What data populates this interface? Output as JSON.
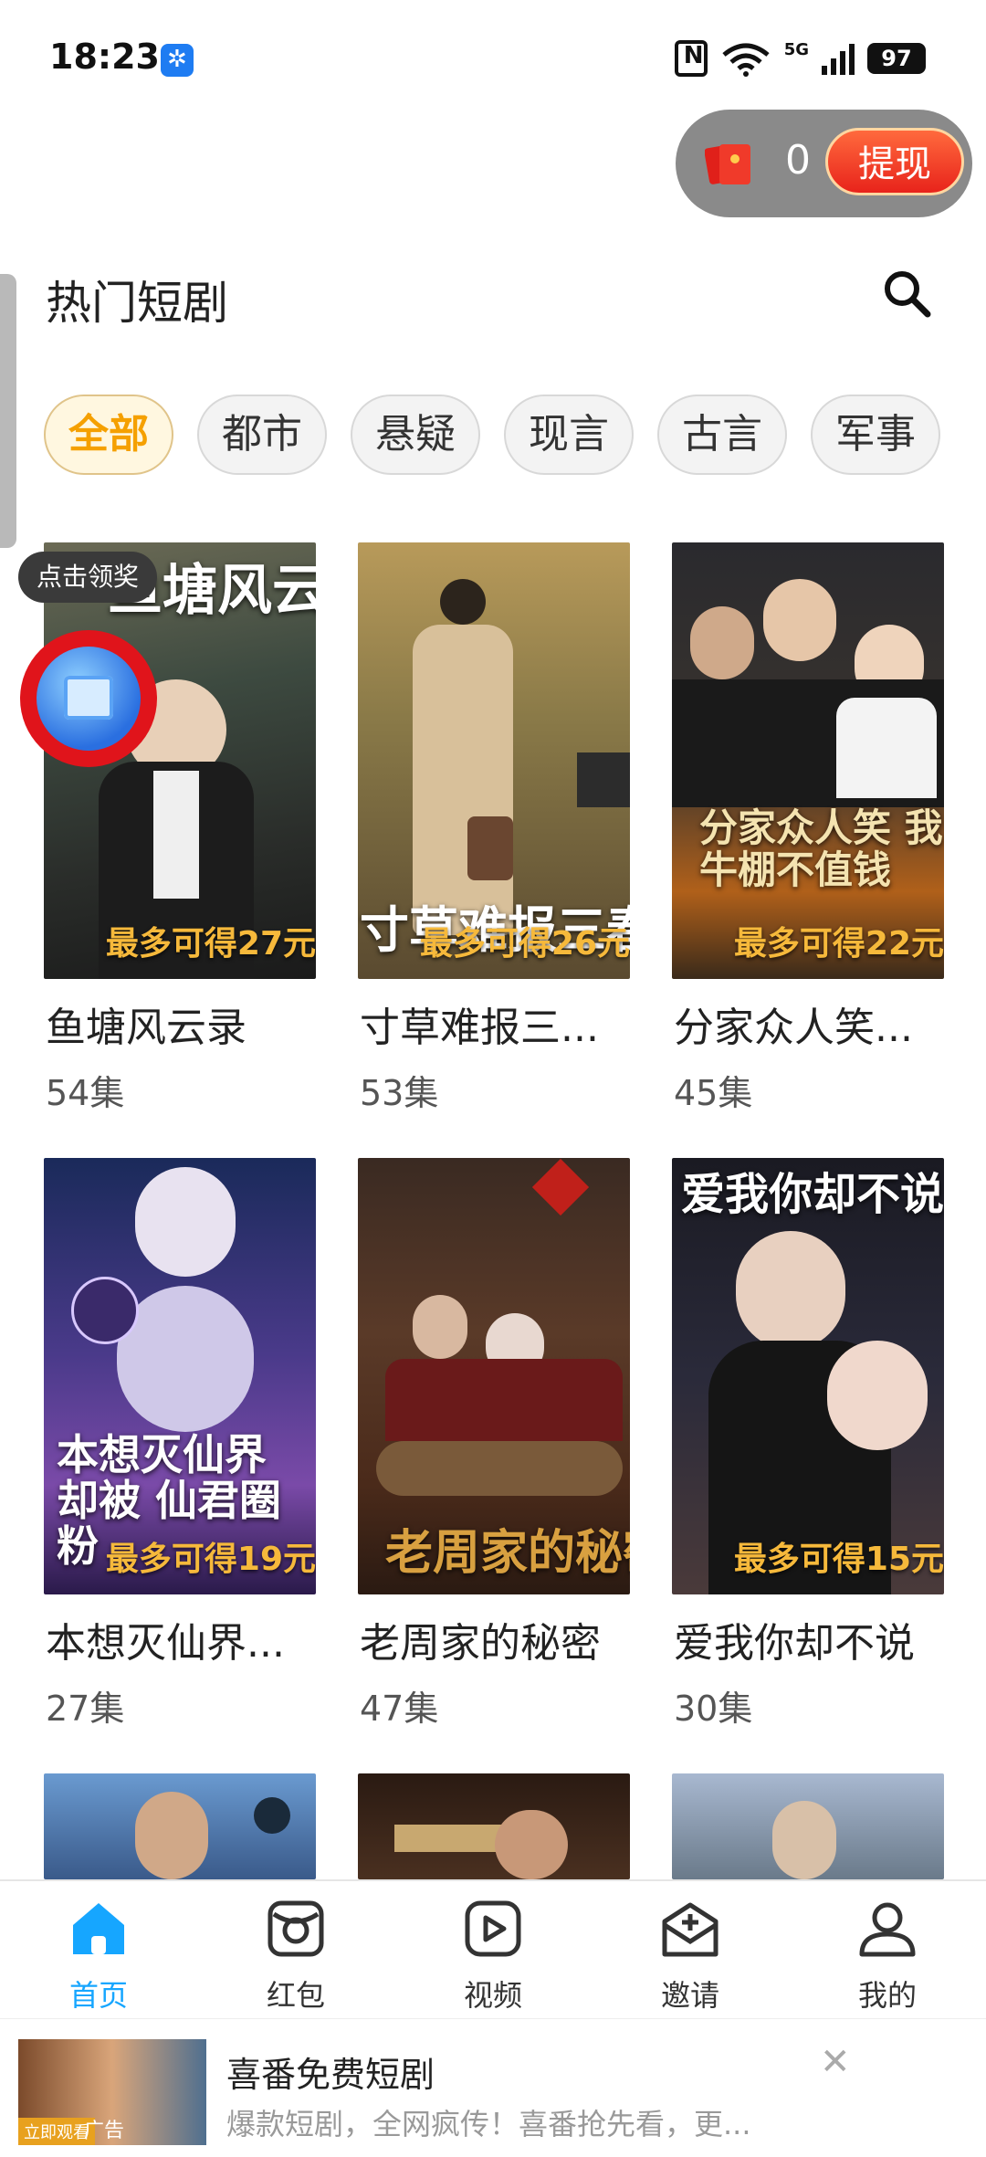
{
  "status_bar": {
    "time": "18:23",
    "network": "5G",
    "battery": "97"
  },
  "reward_pill": {
    "count": "0",
    "withdraw_label": "提现"
  },
  "header": {
    "title": "热门短剧"
  },
  "categories": [
    "全部",
    "都市",
    "悬疑",
    "现言",
    "古言",
    "军事"
  ],
  "reward_badge": "点击领奖",
  "dramas": [
    {
      "title": "鱼塘风云录",
      "episodes": "54集",
      "reward": "最多可得27元",
      "art_text": "鱼塘风云录"
    },
    {
      "title": "寸草难报三...",
      "episodes": "53集",
      "reward": "最多可得26元",
      "art_text": "寸草难报三春"
    },
    {
      "title": "分家众人笑...",
      "episodes": "45集",
      "reward": "最多可得22元",
      "art_text": "分家众人笑 我牛棚不值钱"
    },
    {
      "title": "本想灭仙界...",
      "episodes": "27集",
      "reward": "最多可得19元",
      "art_text": "本想灭仙界 却被 仙君圈粉"
    },
    {
      "title": "老周家的秘密",
      "episodes": "47集",
      "reward": "",
      "art_text": "老周家的秘密"
    },
    {
      "title": "爱我你却不说",
      "episodes": "30集",
      "reward": "最多可得15元",
      "art_text": "爱我你却不说"
    }
  ],
  "bottom_nav": [
    {
      "label": "首页",
      "icon": "home-icon",
      "active": true
    },
    {
      "label": "红包",
      "icon": "red-packet-icon",
      "active": false
    },
    {
      "label": "视频",
      "icon": "video-icon",
      "active": false
    },
    {
      "label": "邀请",
      "icon": "invite-icon",
      "active": false
    },
    {
      "label": "我的",
      "icon": "profile-icon",
      "active": false
    }
  ],
  "ad": {
    "title": "喜番免费短剧",
    "description": "爆款短剧，全网疯传！喜番抢先看，更...",
    "thumb_label": "立即观看",
    "tag": "广告"
  },
  "colors": {
    "accent_orange": "#f5a000",
    "nav_active": "#16a6ff",
    "withdraw_red": "#e8231b"
  }
}
